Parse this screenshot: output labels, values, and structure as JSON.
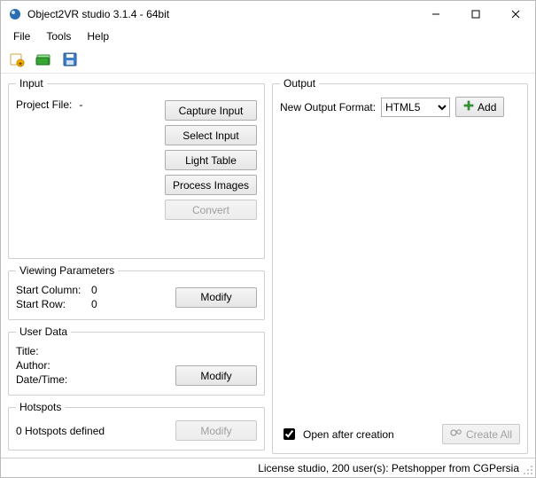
{
  "window": {
    "title": "Object2VR studio 3.1.4 - 64bit"
  },
  "menu": {
    "file": "File",
    "tools": "Tools",
    "help": "Help"
  },
  "groups": {
    "input": {
      "legend": "Input",
      "project_file_label": "Project File:",
      "project_file_value": "-",
      "capture_input": "Capture Input",
      "select_input": "Select Input",
      "light_table": "Light Table",
      "process_images": "Process Images",
      "convert": "Convert"
    },
    "viewing_parameters": {
      "legend": "Viewing Parameters",
      "start_column_label": "Start Column:",
      "start_column_value": "0",
      "start_row_label": "Start Row:",
      "start_row_value": "0",
      "modify": "Modify"
    },
    "user_data": {
      "legend": "User Data",
      "title_label": "Title:",
      "author_label": "Author:",
      "datetime_label": "Date/Time:",
      "modify": "Modify"
    },
    "hotspots": {
      "legend": "Hotspots",
      "status": "0 Hotspots defined",
      "modify": "Modify"
    },
    "output": {
      "legend": "Output",
      "new_output_format_label": "New Output Format:",
      "format_selected": "HTML5",
      "add": "Add",
      "open_after_creation": "Open after creation",
      "create_all": "Create All"
    }
  },
  "status": {
    "text": "License studio, 200 user(s): Petshopper from CGPersia"
  }
}
